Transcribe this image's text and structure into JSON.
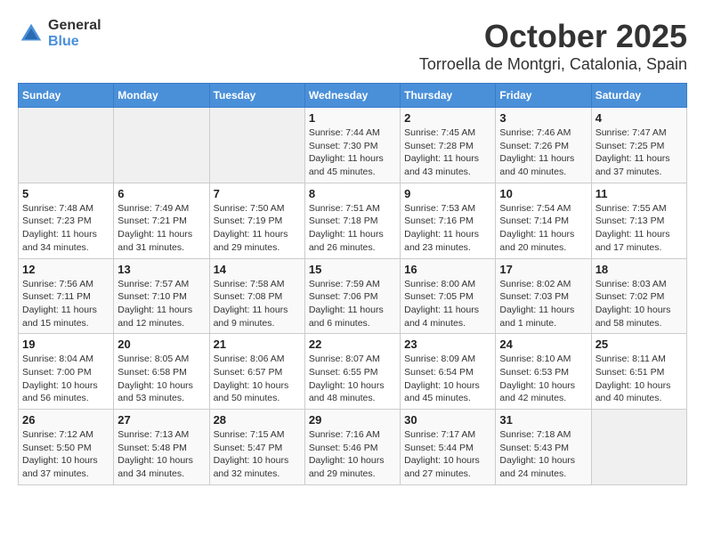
{
  "header": {
    "logo_general": "General",
    "logo_blue": "Blue",
    "month_title": "October 2025",
    "location": "Torroella de Montgri, Catalonia, Spain"
  },
  "days_of_week": [
    "Sunday",
    "Monday",
    "Tuesday",
    "Wednesday",
    "Thursday",
    "Friday",
    "Saturday"
  ],
  "weeks": [
    [
      {
        "day": "",
        "info": ""
      },
      {
        "day": "",
        "info": ""
      },
      {
        "day": "",
        "info": ""
      },
      {
        "day": "1",
        "info": "Sunrise: 7:44 AM\nSunset: 7:30 PM\nDaylight: 11 hours\nand 45 minutes."
      },
      {
        "day": "2",
        "info": "Sunrise: 7:45 AM\nSunset: 7:28 PM\nDaylight: 11 hours\nand 43 minutes."
      },
      {
        "day": "3",
        "info": "Sunrise: 7:46 AM\nSunset: 7:26 PM\nDaylight: 11 hours\nand 40 minutes."
      },
      {
        "day": "4",
        "info": "Sunrise: 7:47 AM\nSunset: 7:25 PM\nDaylight: 11 hours\nand 37 minutes."
      }
    ],
    [
      {
        "day": "5",
        "info": "Sunrise: 7:48 AM\nSunset: 7:23 PM\nDaylight: 11 hours\nand 34 minutes."
      },
      {
        "day": "6",
        "info": "Sunrise: 7:49 AM\nSunset: 7:21 PM\nDaylight: 11 hours\nand 31 minutes."
      },
      {
        "day": "7",
        "info": "Sunrise: 7:50 AM\nSunset: 7:19 PM\nDaylight: 11 hours\nand 29 minutes."
      },
      {
        "day": "8",
        "info": "Sunrise: 7:51 AM\nSunset: 7:18 PM\nDaylight: 11 hours\nand 26 minutes."
      },
      {
        "day": "9",
        "info": "Sunrise: 7:53 AM\nSunset: 7:16 PM\nDaylight: 11 hours\nand 23 minutes."
      },
      {
        "day": "10",
        "info": "Sunrise: 7:54 AM\nSunset: 7:14 PM\nDaylight: 11 hours\nand 20 minutes."
      },
      {
        "day": "11",
        "info": "Sunrise: 7:55 AM\nSunset: 7:13 PM\nDaylight: 11 hours\nand 17 minutes."
      }
    ],
    [
      {
        "day": "12",
        "info": "Sunrise: 7:56 AM\nSunset: 7:11 PM\nDaylight: 11 hours\nand 15 minutes."
      },
      {
        "day": "13",
        "info": "Sunrise: 7:57 AM\nSunset: 7:10 PM\nDaylight: 11 hours\nand 12 minutes."
      },
      {
        "day": "14",
        "info": "Sunrise: 7:58 AM\nSunset: 7:08 PM\nDaylight: 11 hours\nand 9 minutes."
      },
      {
        "day": "15",
        "info": "Sunrise: 7:59 AM\nSunset: 7:06 PM\nDaylight: 11 hours\nand 6 minutes."
      },
      {
        "day": "16",
        "info": "Sunrise: 8:00 AM\nSunset: 7:05 PM\nDaylight: 11 hours\nand 4 minutes."
      },
      {
        "day": "17",
        "info": "Sunrise: 8:02 AM\nSunset: 7:03 PM\nDaylight: 11 hours\nand 1 minute."
      },
      {
        "day": "18",
        "info": "Sunrise: 8:03 AM\nSunset: 7:02 PM\nDaylight: 10 hours\nand 58 minutes."
      }
    ],
    [
      {
        "day": "19",
        "info": "Sunrise: 8:04 AM\nSunset: 7:00 PM\nDaylight: 10 hours\nand 56 minutes."
      },
      {
        "day": "20",
        "info": "Sunrise: 8:05 AM\nSunset: 6:58 PM\nDaylight: 10 hours\nand 53 minutes."
      },
      {
        "day": "21",
        "info": "Sunrise: 8:06 AM\nSunset: 6:57 PM\nDaylight: 10 hours\nand 50 minutes."
      },
      {
        "day": "22",
        "info": "Sunrise: 8:07 AM\nSunset: 6:55 PM\nDaylight: 10 hours\nand 48 minutes."
      },
      {
        "day": "23",
        "info": "Sunrise: 8:09 AM\nSunset: 6:54 PM\nDaylight: 10 hours\nand 45 minutes."
      },
      {
        "day": "24",
        "info": "Sunrise: 8:10 AM\nSunset: 6:53 PM\nDaylight: 10 hours\nand 42 minutes."
      },
      {
        "day": "25",
        "info": "Sunrise: 8:11 AM\nSunset: 6:51 PM\nDaylight: 10 hours\nand 40 minutes."
      }
    ],
    [
      {
        "day": "26",
        "info": "Sunrise: 7:12 AM\nSunset: 5:50 PM\nDaylight: 10 hours\nand 37 minutes."
      },
      {
        "day": "27",
        "info": "Sunrise: 7:13 AM\nSunset: 5:48 PM\nDaylight: 10 hours\nand 34 minutes."
      },
      {
        "day": "28",
        "info": "Sunrise: 7:15 AM\nSunset: 5:47 PM\nDaylight: 10 hours\nand 32 minutes."
      },
      {
        "day": "29",
        "info": "Sunrise: 7:16 AM\nSunset: 5:46 PM\nDaylight: 10 hours\nand 29 minutes."
      },
      {
        "day": "30",
        "info": "Sunrise: 7:17 AM\nSunset: 5:44 PM\nDaylight: 10 hours\nand 27 minutes."
      },
      {
        "day": "31",
        "info": "Sunrise: 7:18 AM\nSunset: 5:43 PM\nDaylight: 10 hours\nand 24 minutes."
      },
      {
        "day": "",
        "info": ""
      }
    ]
  ]
}
